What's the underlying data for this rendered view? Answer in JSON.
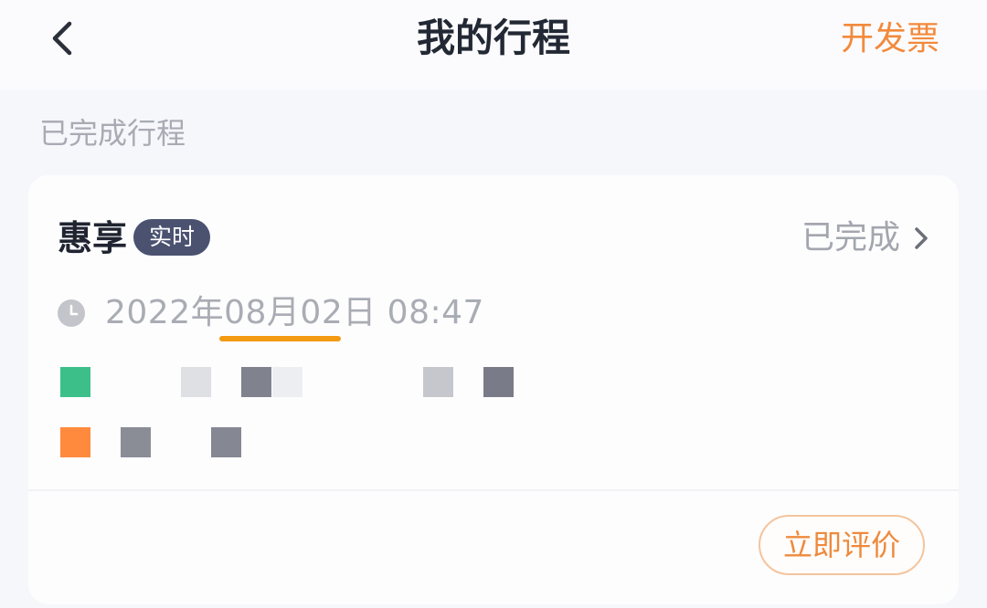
{
  "nav": {
    "title": "我的行程",
    "invoice_label": "开发票"
  },
  "section": {
    "label": "已完成行程"
  },
  "trip": {
    "service_name": "惠享",
    "tag": "实时",
    "status": "已完成",
    "datetime": "2022年08月02日  08:47",
    "rate_label": "立即评价"
  },
  "colors": {
    "accent": "#f28a3c",
    "tag_bg": "#4a5270",
    "start_marker": "#3dbf8a",
    "end_marker": "#ff8a3d",
    "underline": "#f49a13"
  },
  "icons": {
    "back": "chevron-left-icon",
    "status": "chevron-right-icon",
    "time": "clock-icon"
  }
}
